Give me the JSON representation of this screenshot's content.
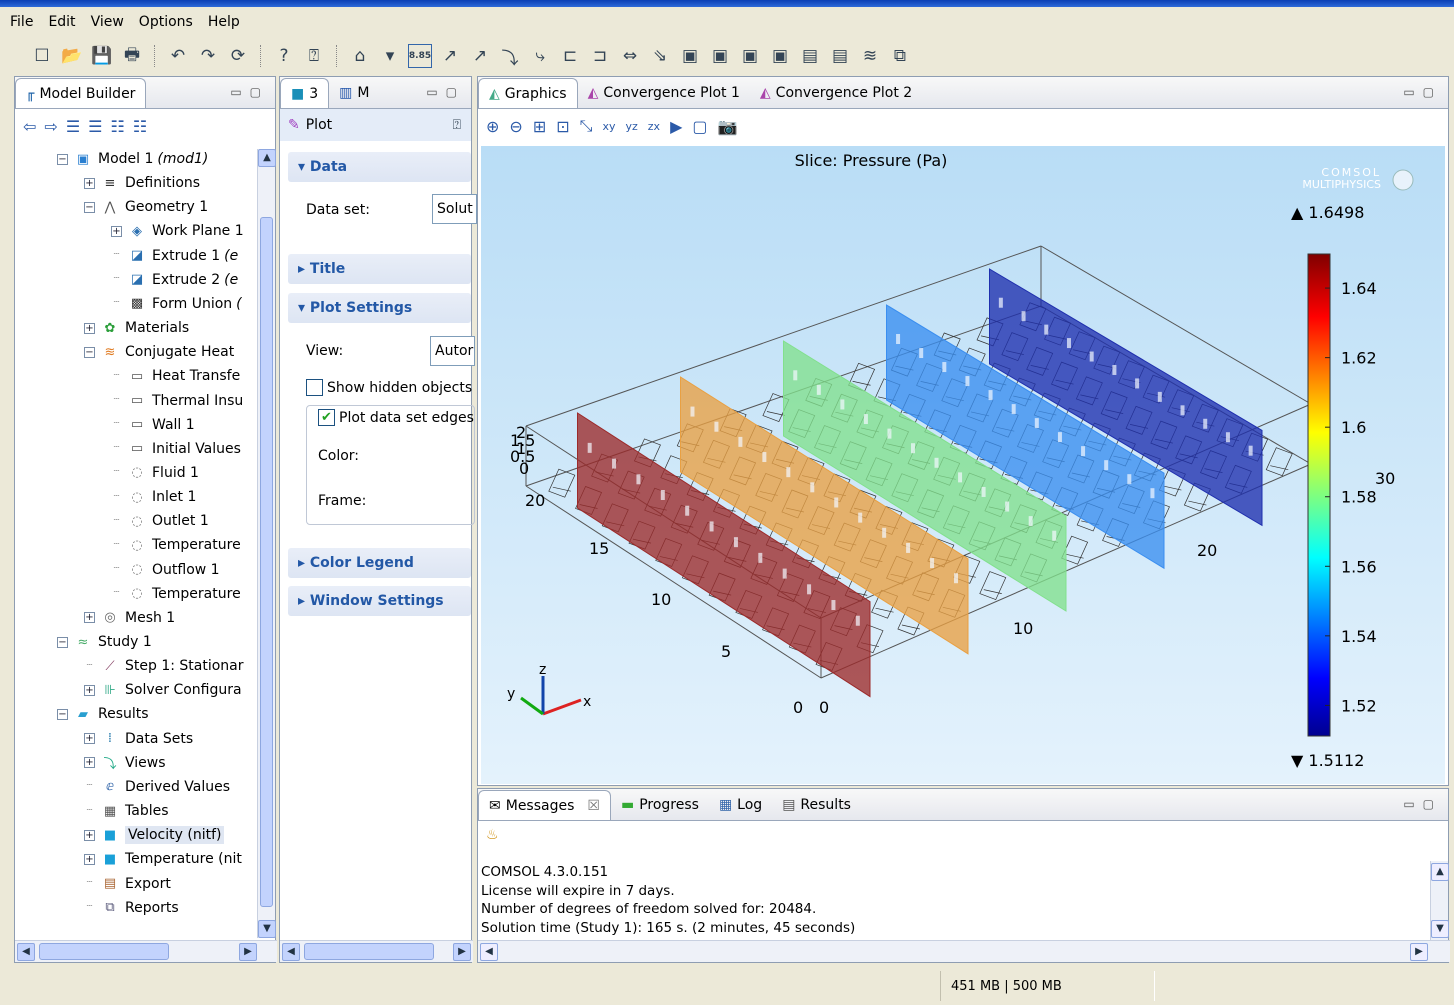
{
  "menu": [
    "File",
    "Edit",
    "View",
    "Options",
    "Help"
  ],
  "model_builder": {
    "tab_label": "Model Builder",
    "tree": [
      {
        "label": "Model 1",
        "suffix": "(mod1)",
        "exp": "minus",
        "icon": "model-icon"
      },
      {
        "label": "Definitions",
        "exp": "plus",
        "icon": "definitions-icon"
      },
      {
        "label": "Geometry 1",
        "exp": "minus",
        "icon": "geometry-icon"
      },
      {
        "label": "Work Plane 1",
        "exp": "plus",
        "icon": "workplane-icon"
      },
      {
        "label": "Extrude 1",
        "suffix": "(e",
        "icon": "extrude-icon"
      },
      {
        "label": "Extrude 2",
        "suffix": "(e",
        "icon": "extrude-icon"
      },
      {
        "label": "Form Union",
        "suffix": "(",
        "icon": "form-union-icon"
      },
      {
        "label": "Materials",
        "exp": "plus",
        "icon": "materials-icon"
      },
      {
        "label": "Conjugate Heat",
        "exp": "minus",
        "icon": "physics-icon"
      },
      {
        "label": "Heat Transfe",
        "icon": "node-d-icon"
      },
      {
        "label": "Thermal Insu",
        "icon": "node-d-icon"
      },
      {
        "label": "Wall 1",
        "icon": "node-d-icon"
      },
      {
        "label": "Initial Values",
        "icon": "node-d-icon"
      },
      {
        "label": "Fluid 1",
        "icon": "node-icon"
      },
      {
        "label": "Inlet 1",
        "icon": "node-icon"
      },
      {
        "label": "Outlet 1",
        "icon": "node-icon"
      },
      {
        "label": "Temperature",
        "icon": "node-icon"
      },
      {
        "label": "Outflow 1",
        "icon": "node-icon"
      },
      {
        "label": "Temperature",
        "icon": "node-icon"
      },
      {
        "label": "Mesh 1",
        "exp": "plus",
        "icon": "mesh-icon"
      },
      {
        "label": "Study 1",
        "exp": "minus",
        "icon": "study-icon"
      },
      {
        "label": "Step 1: Stationar",
        "icon": "step-icon"
      },
      {
        "label": "Solver Configura",
        "exp": "plus",
        "icon": "solver-icon"
      },
      {
        "label": "Results",
        "exp": "minus",
        "icon": "results-icon"
      },
      {
        "label": "Data Sets",
        "exp": "plus",
        "icon": "datasets-icon"
      },
      {
        "label": "Views",
        "exp": "plus",
        "icon": "views-icon"
      },
      {
        "label": "Derived Values",
        "icon": "derived-values-icon"
      },
      {
        "label": "Tables",
        "icon": "tables-icon"
      },
      {
        "label": "Velocity (nitf)",
        "exp": "plus",
        "icon": "plot-group-icon",
        "selected": true
      },
      {
        "label": "Temperature (nit",
        "exp": "plus",
        "icon": "plot-group-icon"
      },
      {
        "label": "Export",
        "icon": "export-icon"
      },
      {
        "label": "Reports",
        "icon": "reports-icon"
      }
    ]
  },
  "settings": {
    "tab1": "3",
    "tab2": "M",
    "header": "Plot",
    "sections": {
      "data": "Data",
      "title": "Title",
      "plot_settings": "Plot Settings",
      "color_legend": "Color Legend",
      "window_settings": "Window Settings"
    },
    "data_set_label": "Data set:",
    "data_set_value": "Solut",
    "view_label": "View:",
    "view_value": "Autor",
    "show_hidden": "Show hidden objects",
    "plot_edges": "Plot data set edges",
    "color_label": "Color:",
    "frame_label": "Frame:"
  },
  "graphics": {
    "tabs": [
      "Graphics",
      "Convergence Plot 1",
      "Convergence Plot 2"
    ],
    "plot_title": "Slice: Pressure (Pa)",
    "watermark_line1": "COMSOL",
    "watermark_line2": "MULTIPHYSICS",
    "legend": {
      "max_label": "▲ 1.6498",
      "min_label": "▼ 1.5112",
      "max": 1.6498,
      "min": 1.5112,
      "ticks": [
        "1.64",
        "1.62",
        "1.6",
        "1.58",
        "1.56",
        "1.54",
        "1.52"
      ]
    },
    "axis_labels": {
      "x_ticks": [
        "0",
        "10",
        "20"
      ],
      "y_ticks": [
        "0",
        "5",
        "10",
        "15",
        "20"
      ],
      "y_far_tick": "30",
      "z_ticks": [
        "2",
        "1.5",
        "1",
        "0.5",
        "0"
      ]
    },
    "triad": {
      "x": "x",
      "y": "y",
      "z": "z"
    },
    "slice_colors": [
      "#9c2a2a",
      "#e9a042",
      "#82e08d",
      "#3a8ef0",
      "#1f2fae"
    ]
  },
  "messages": {
    "tabs": [
      "Messages",
      "Progress",
      "Log",
      "Results"
    ],
    "lines": [
      "COMSOL 4.3.0.151",
      "License will expire in 7 days.",
      "Number of degrees of freedom solved for: 20484.",
      "Solution time (Study 1): 165 s. (2 minutes, 45 seconds)"
    ]
  },
  "status": {
    "memory": "451 MB | 500 MB"
  }
}
